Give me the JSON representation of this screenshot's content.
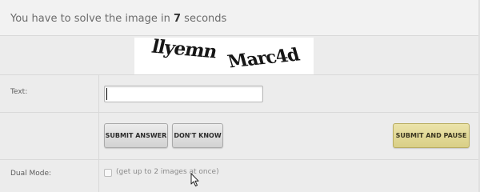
{
  "header": {
    "prefix": "You have to solve the image in ",
    "seconds": "7",
    "suffix": " seconds"
  },
  "captcha": {
    "words": [
      "llyemn",
      "Marc4d"
    ]
  },
  "text_field": {
    "label": "Text:",
    "value": ""
  },
  "buttons": {
    "submit_answer": "SUBMIT ANSWER",
    "dont_know": "DON'T KNOW",
    "submit_and_pause": "SUBMIT AND PAUSE"
  },
  "dual_mode": {
    "label": "Dual Mode:",
    "checkbox_text": "(get up to 2 images at once)",
    "checked": false
  },
  "colors": {
    "pause_button": "#d9cf86",
    "background": "#ececec"
  }
}
